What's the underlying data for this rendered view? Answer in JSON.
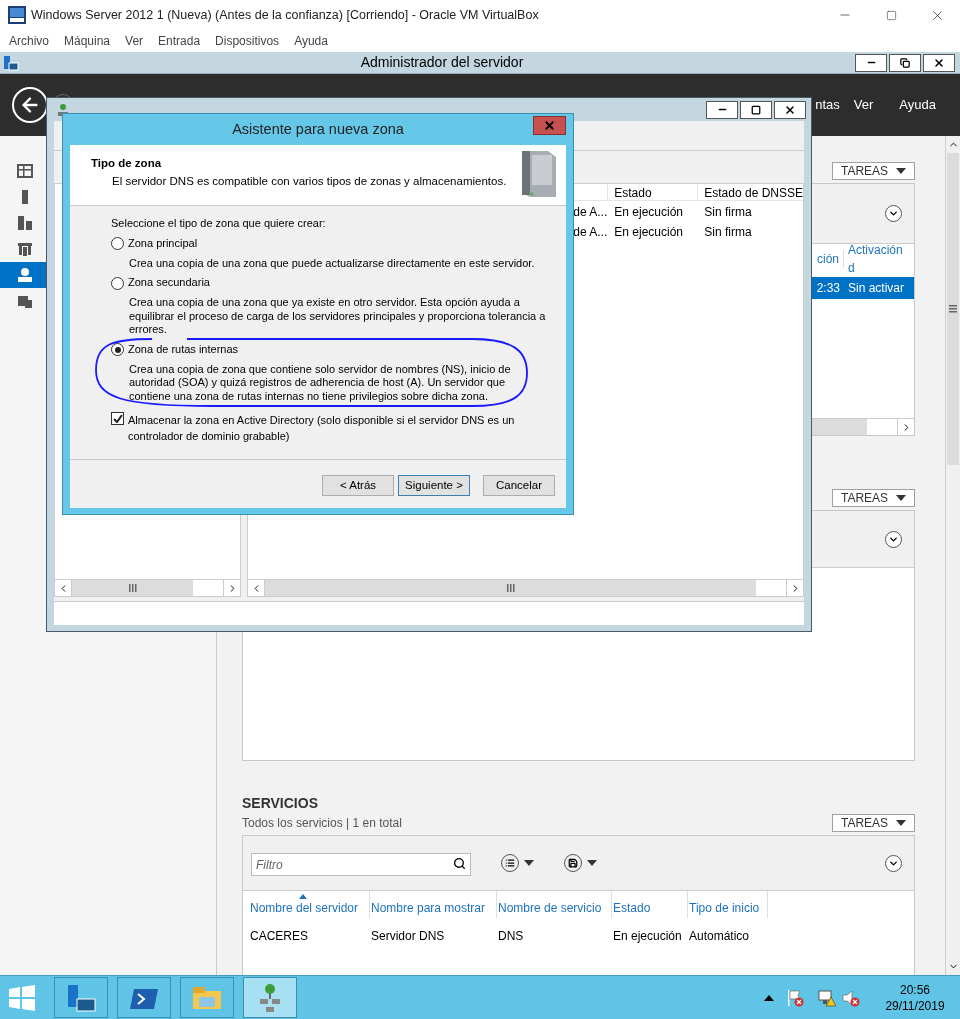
{
  "vm_window": {
    "title": "Windows Server 2012 1 (Nueva) (Antes de la confianza) [Corriendo] - Oracle VM VirtualBox",
    "menu": [
      "Archivo",
      "Máquina",
      "Ver",
      "Entrada",
      "Dispositivos",
      "Ayuda"
    ]
  },
  "server_manager": {
    "title": "Administrador del servidor",
    "header_menu": [
      "ntas",
      "Ver",
      "Ayuda"
    ],
    "sidebar": [
      {
        "kind": "dashboard",
        "selected": false
      },
      {
        "kind": "server",
        "selected": false
      },
      {
        "kind": "servers",
        "selected": false
      },
      {
        "kind": "directory",
        "selected": false
      },
      {
        "kind": "dns",
        "selected": true
      },
      {
        "kind": "files",
        "selected": false
      }
    ],
    "events_panel": {
      "tasks": "TAREAS",
      "columns": [
        "ción",
        "Activación d"
      ],
      "rows": [
        {
          "cells": [
            "2:33",
            "Sin activar"
          ],
          "selected": true
        }
      ]
    },
    "second_panel": {
      "tasks": "TAREAS"
    },
    "services": {
      "title": "SERVICIOS",
      "subtitle": "Todos los servicios | 1 en total",
      "tasks": "TAREAS",
      "filter_placeholder": "Filtro",
      "columns": [
        {
          "label": "Nombre del servidor",
          "sorted": true
        },
        {
          "label": "Nombre para mostrar",
          "sorted": false
        },
        {
          "label": "Nombre de servicio",
          "sorted": false
        },
        {
          "label": "Estado",
          "sorted": false
        },
        {
          "label": "Tipo de inicio",
          "sorted": false
        }
      ],
      "rows": [
        [
          "CACERES",
          "Servidor DNS",
          "DNS",
          "En ejecución",
          "Automático"
        ]
      ]
    }
  },
  "dns_manager": {
    "columns": [
      null,
      "Estado",
      "Estado de DNSSE"
    ],
    "rows": [
      [
        "de A...",
        "En ejecución",
        "Sin firma"
      ],
      [
        "de A...",
        "En ejecución",
        "Sin firma"
      ]
    ]
  },
  "wizard": {
    "title": "Asistente para nueva zona",
    "heading": "Tipo de zona",
    "subheading": "El servidor DNS es compatible con varios tipos de zonas y almacenamientos.",
    "prompt": "Seleccione el tipo de zona que quiere crear:",
    "options": [
      {
        "label": "Zona principal",
        "description": "Crea una copia de una zona que puede actualizarse directamente en este servidor.",
        "selected": false
      },
      {
        "label": "Zona secundaria",
        "description": "Crea una copia de una zona que ya existe en otro servidor. Esta opción ayuda a equilibrar el proceso de carga de los servidores principales y proporciona tolerancia a errores.",
        "selected": false
      },
      {
        "label": "Zona de rutas internas",
        "description": "Crea una copia de zona que contiene solo servidor de nombres (NS), inicio de autoridad (SOA) y quizá registros de adherencia de host (A). Un servidor que contiene una zona de rutas internas no tiene privilegios sobre dicha zona.",
        "selected": true
      }
    ],
    "store_in_ad": {
      "label": "Almacenar la zona en Active Directory (solo disponible si el servidor DNS es un controlador de dominio grabable)",
      "checked": true
    },
    "buttons": [
      {
        "label": "< Atrás",
        "default": false
      },
      {
        "label": "Siguiente >",
        "default": true
      },
      {
        "label": "Cancelar",
        "default": false
      }
    ]
  },
  "taskbar": {
    "apps": [
      {
        "kind": "server-manager",
        "active": false
      },
      {
        "kind": "powershell",
        "active": false
      },
      {
        "kind": "explorer",
        "active": false
      },
      {
        "kind": "dns",
        "active": true
      }
    ],
    "time": "20:56",
    "date": "29/11/2019"
  }
}
